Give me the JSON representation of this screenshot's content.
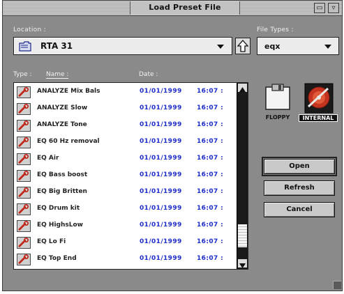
{
  "window": {
    "title": "Load Preset File"
  },
  "location": {
    "label": "Location :",
    "value": "RTA 31"
  },
  "file_types": {
    "label": "File Types :",
    "value": "eqx"
  },
  "columns": {
    "type": "Type :",
    "name": "Name :",
    "date": "Date :"
  },
  "files": [
    {
      "name": "ANALYZE Mix Bals",
      "date": "01/01/1999",
      "time": "16:07 :"
    },
    {
      "name": "ANALYZE Slow",
      "date": "01/01/1999",
      "time": "16:07 :"
    },
    {
      "name": "ANALYZE Tone",
      "date": "01/01/1999",
      "time": "16:07 :"
    },
    {
      "name": "EQ 60 Hz removal",
      "date": "01/01/1999",
      "time": "16:07 :"
    },
    {
      "name": "EQ Air",
      "date": "01/01/1999",
      "time": "16:07 :"
    },
    {
      "name": "EQ Bass boost",
      "date": "01/01/1999",
      "time": "16:07 :"
    },
    {
      "name": "EQ Big Britten",
      "date": "01/01/1999",
      "time": "16:07 :"
    },
    {
      "name": "EQ Drum kit",
      "date": "01/01/1999",
      "time": "16:07 :"
    },
    {
      "name": "EQ HighsLow",
      "date": "01/01/1999",
      "time": "16:07 :"
    },
    {
      "name": "EQ Lo Fi",
      "date": "01/01/1999",
      "time": "16:07 :"
    },
    {
      "name": "EQ Top End",
      "date": "01/01/1999",
      "time": "16:07 :"
    }
  ],
  "scroll": {
    "position": 0.92
  },
  "disks": {
    "floppy_label": "FLOPPY",
    "internal_label": "INTERNAL"
  },
  "buttons": {
    "open": "Open",
    "refresh": "Refresh",
    "cancel": "Cancel"
  },
  "colors": {
    "window_bg": "#8a8a8a",
    "date_text": "#1e2cc8",
    "list_bg": "#ffffff"
  },
  "icons": {
    "file_icon": "wrench-file-icon",
    "location_icon": "folder-icon",
    "up_folder_icon": "up-arrow-icon"
  }
}
